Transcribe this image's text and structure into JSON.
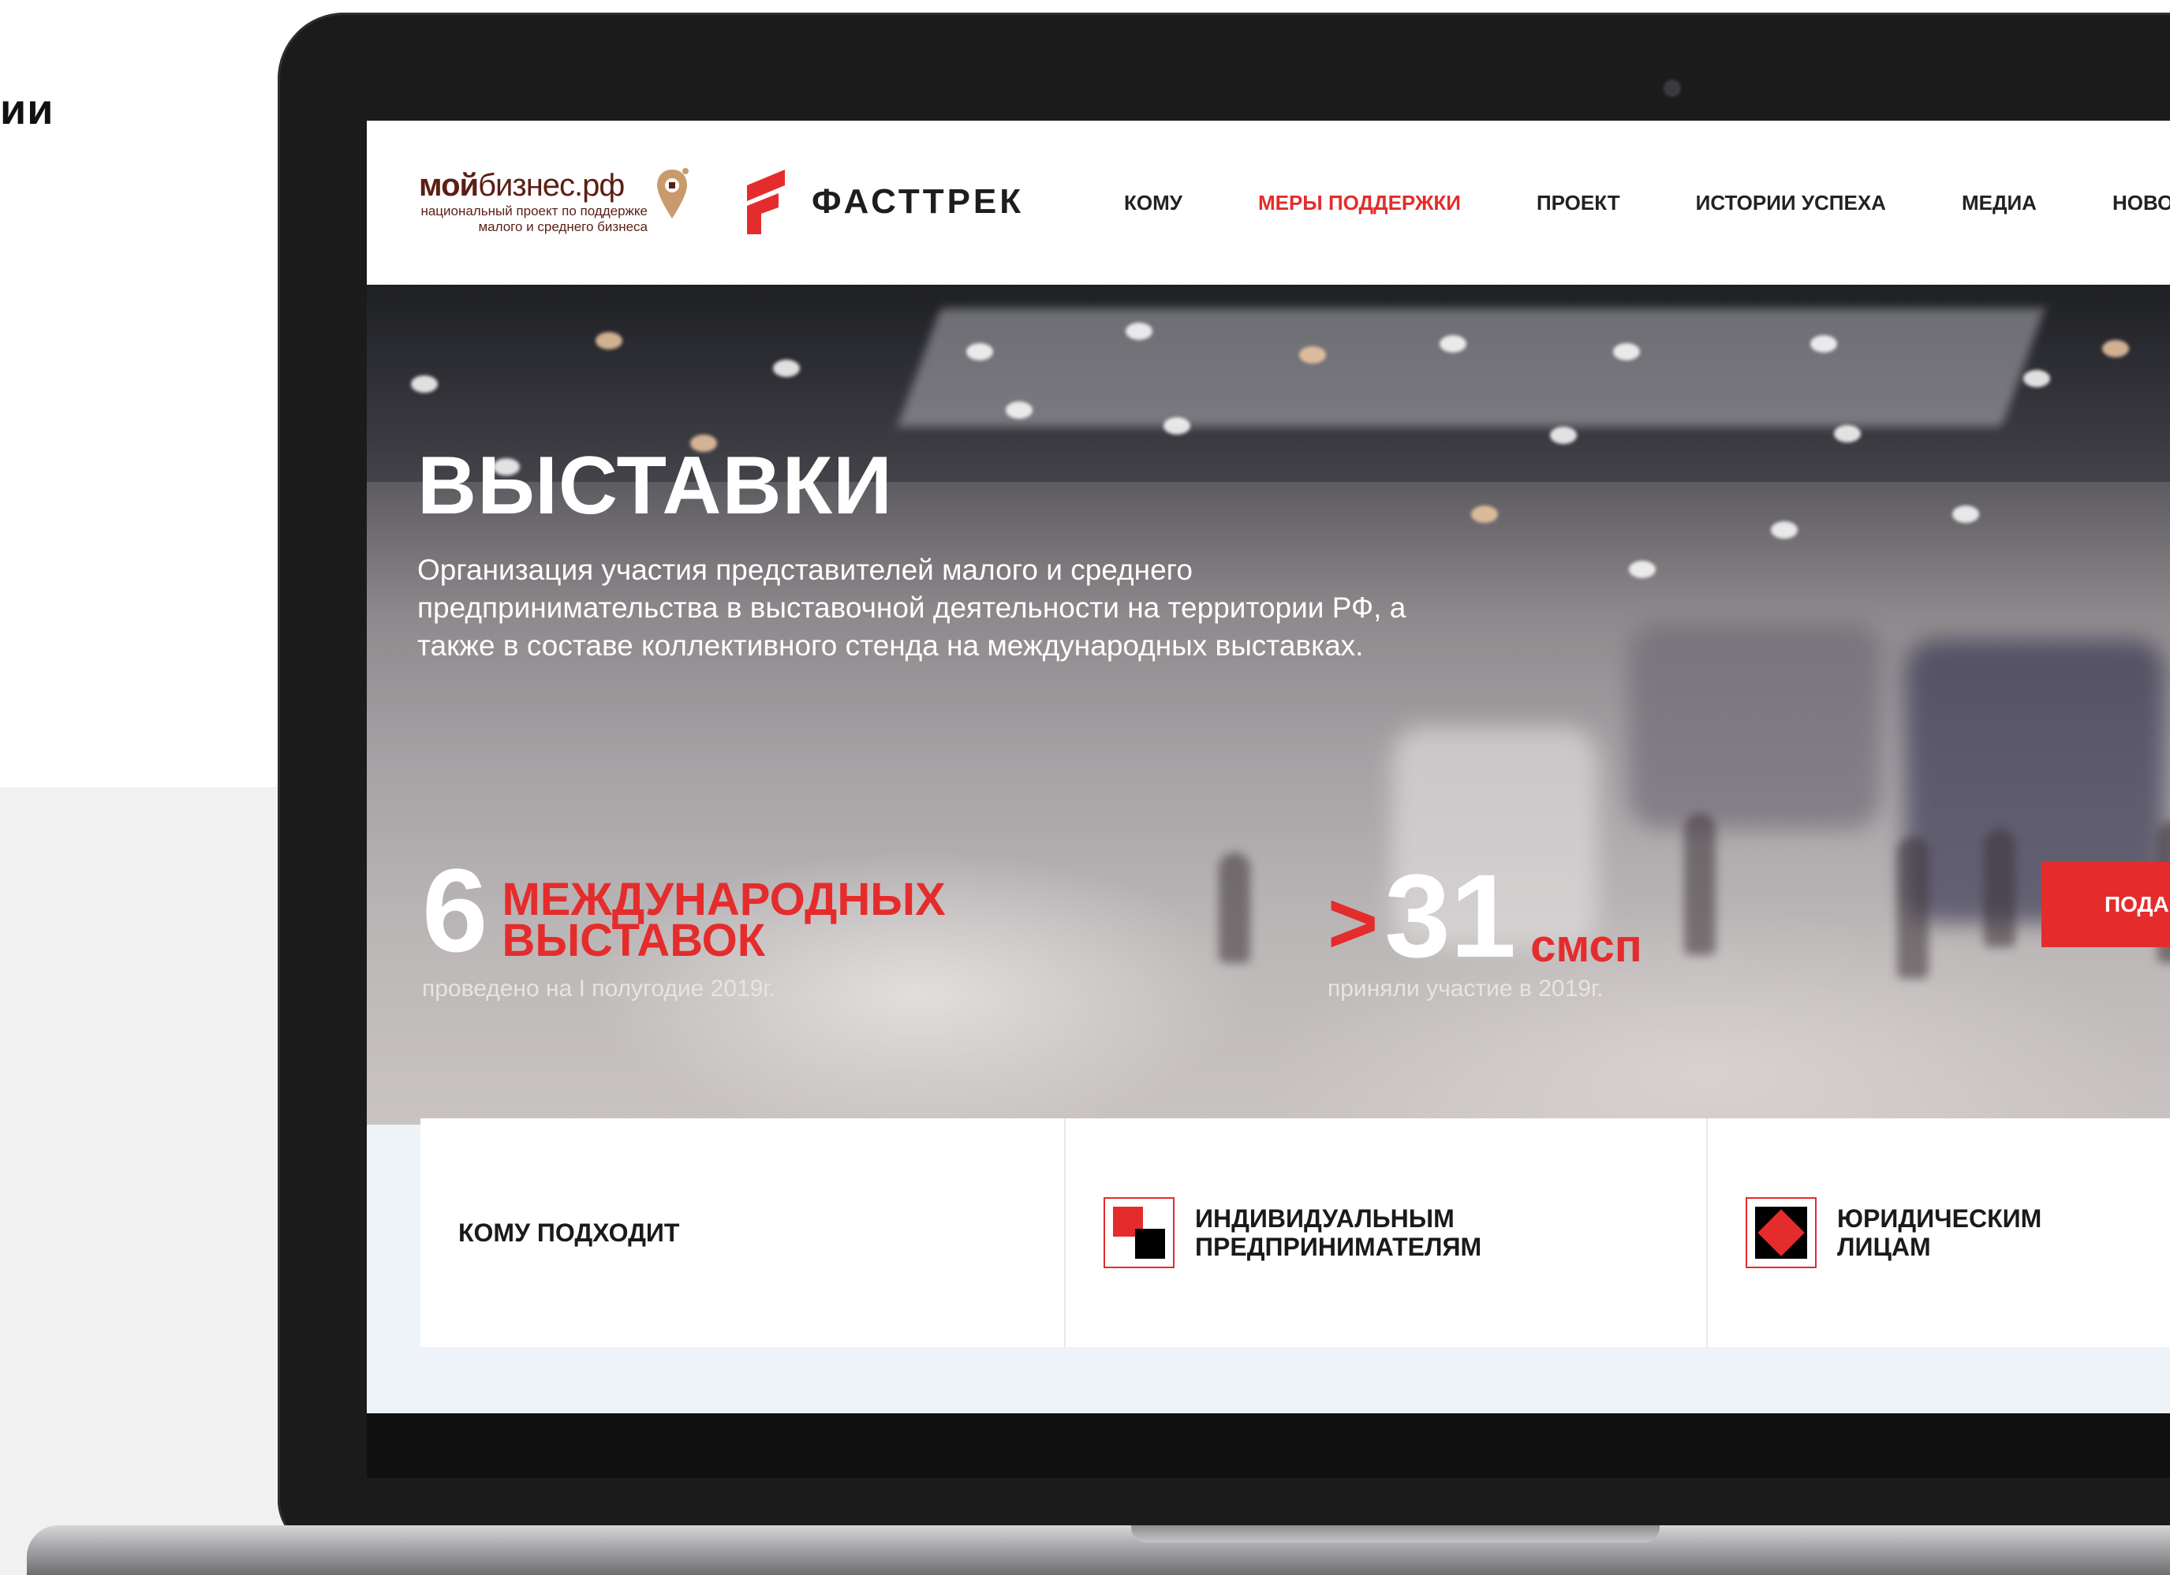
{
  "outside": {
    "text": "ии"
  },
  "site": {
    "logo_primary": {
      "bold": "мой",
      "rest": "бизнес.рф",
      "tagline_1": "национальный проект по поддержке",
      "tagline_2": "малого и среднего бизнеса"
    },
    "logo_secondary": {
      "text": "ФАСТТРЕК"
    },
    "nav": [
      {
        "label": "КОМУ"
      },
      {
        "label": "МЕРЫ ПОДДЕРЖКИ"
      },
      {
        "label": "ПРОЕКТ"
      },
      {
        "label": "ИСТОРИИ УСПЕХА"
      },
      {
        "label": "МЕДИА"
      },
      {
        "label": "НОВОСТИ"
      }
    ]
  },
  "hero": {
    "title": "ВЫСТАВКИ",
    "description": "Организация участия представителей малого и среднего предпринимательства в выставочной деятельности на территории РФ, а также в составе коллективного стенда на международных выставках.",
    "stat1": {
      "number": "6",
      "label_1": "МЕЖДУНАРОДНЫХ",
      "label_2": "ВЫСТАВОК",
      "sub": "проведено на I полугодие 2019г."
    },
    "stat2": {
      "prefix": ">",
      "number": "31",
      "label": "смсп",
      "sub": "приняли участие в 2019г."
    },
    "apply_button": "ПОДА"
  },
  "cards": {
    "title": "КОМУ ПОДХОДИТ",
    "items": [
      {
        "label_1": "ИНДИВИДУАЛЬНЫМ",
        "label_2": "ПРЕДПРИНИМАТЕЛЯМ",
        "icon": "split-squares-icon"
      },
      {
        "label_1": "ЮРИДИЧЕСКИМ",
        "label_2": "ЛИЦАМ",
        "icon": "diamond-square-icon"
      }
    ]
  },
  "colors": {
    "accent": "#e52c2c",
    "brand_brown": "#5b1f14",
    "dark_text": "#1a1a1a"
  }
}
